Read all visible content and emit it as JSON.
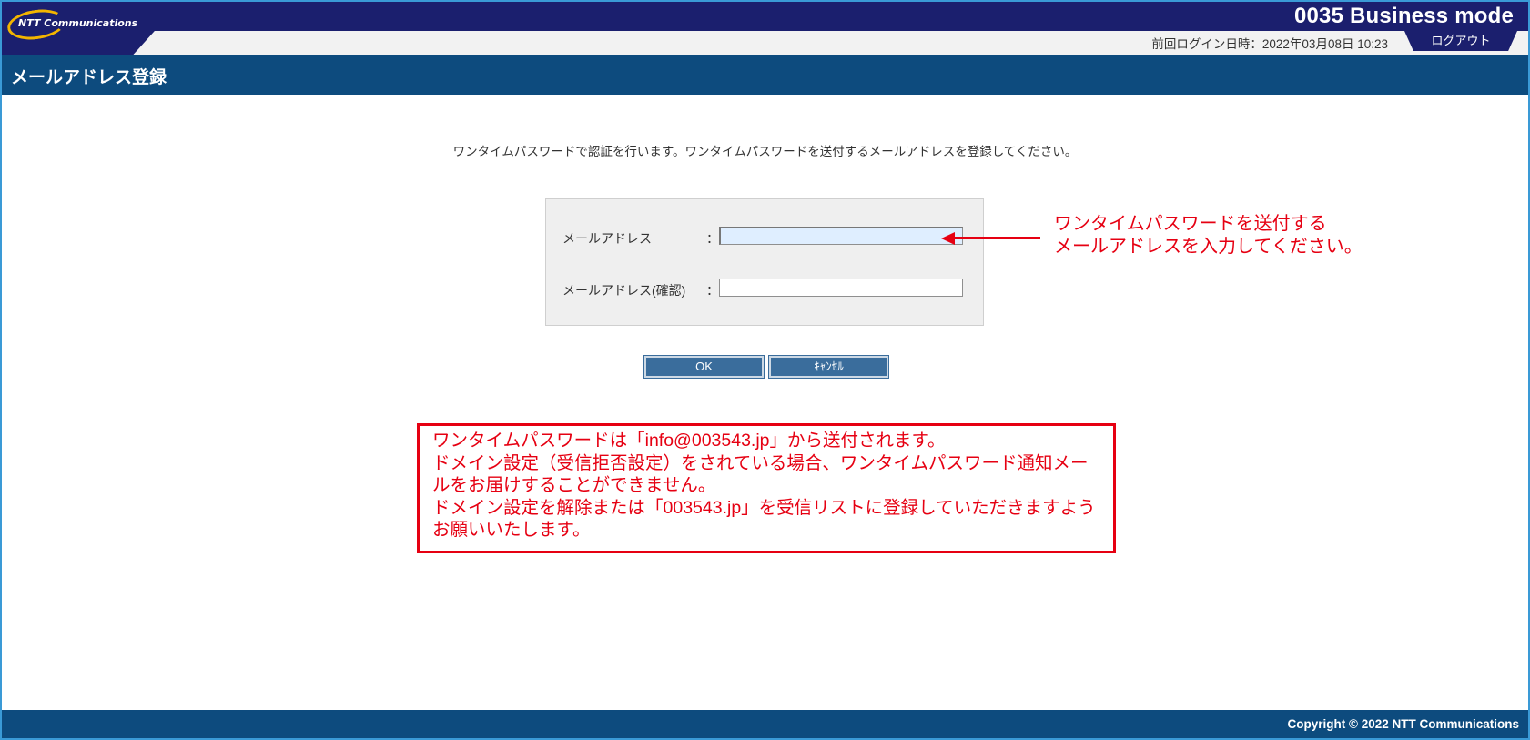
{
  "header": {
    "logo_text": "NTT Communications",
    "brand": "0035 Business mode",
    "last_login": "前回ログイン日時：2022年03月08日 10:23",
    "logout_label": "ログアウト"
  },
  "page": {
    "title": "メールアドレス登録",
    "instruction": "ワンタイムパスワードで認証を行います。ワンタイムパスワードを送付するメールアドレスを登録してください。"
  },
  "form": {
    "email_label": "メールアドレス",
    "email_confirm_label": "メールアドレス(確認)",
    "colon": "：",
    "email_value": "",
    "email_confirm_value": ""
  },
  "buttons": {
    "ok_label": "OK",
    "cancel_label": "ｷｬﾝｾﾙ"
  },
  "callout": {
    "line1": "ワンタイムパスワードを送付する",
    "line2": "メールアドレスを入力してください。"
  },
  "notice": {
    "line1": "ワンタイムパスワードは「info@003543.jp」から送付されます。",
    "line2": "ドメイン設定（受信拒否設定）をされている場合、ワンタイムパスワード通知メールをお届けすることができません。",
    "line3": "ドメイン設定を解除または「003543.jp」を受信リストに登録していただきますようお願いいたします。"
  },
  "footer": {
    "copyright": "Copyright © 2022 NTT Communications"
  },
  "colors": {
    "navy": "#1b1f6e",
    "title_bar": "#0d4b7e",
    "button": "#3a6d9c",
    "annotation_red": "#e60012"
  }
}
